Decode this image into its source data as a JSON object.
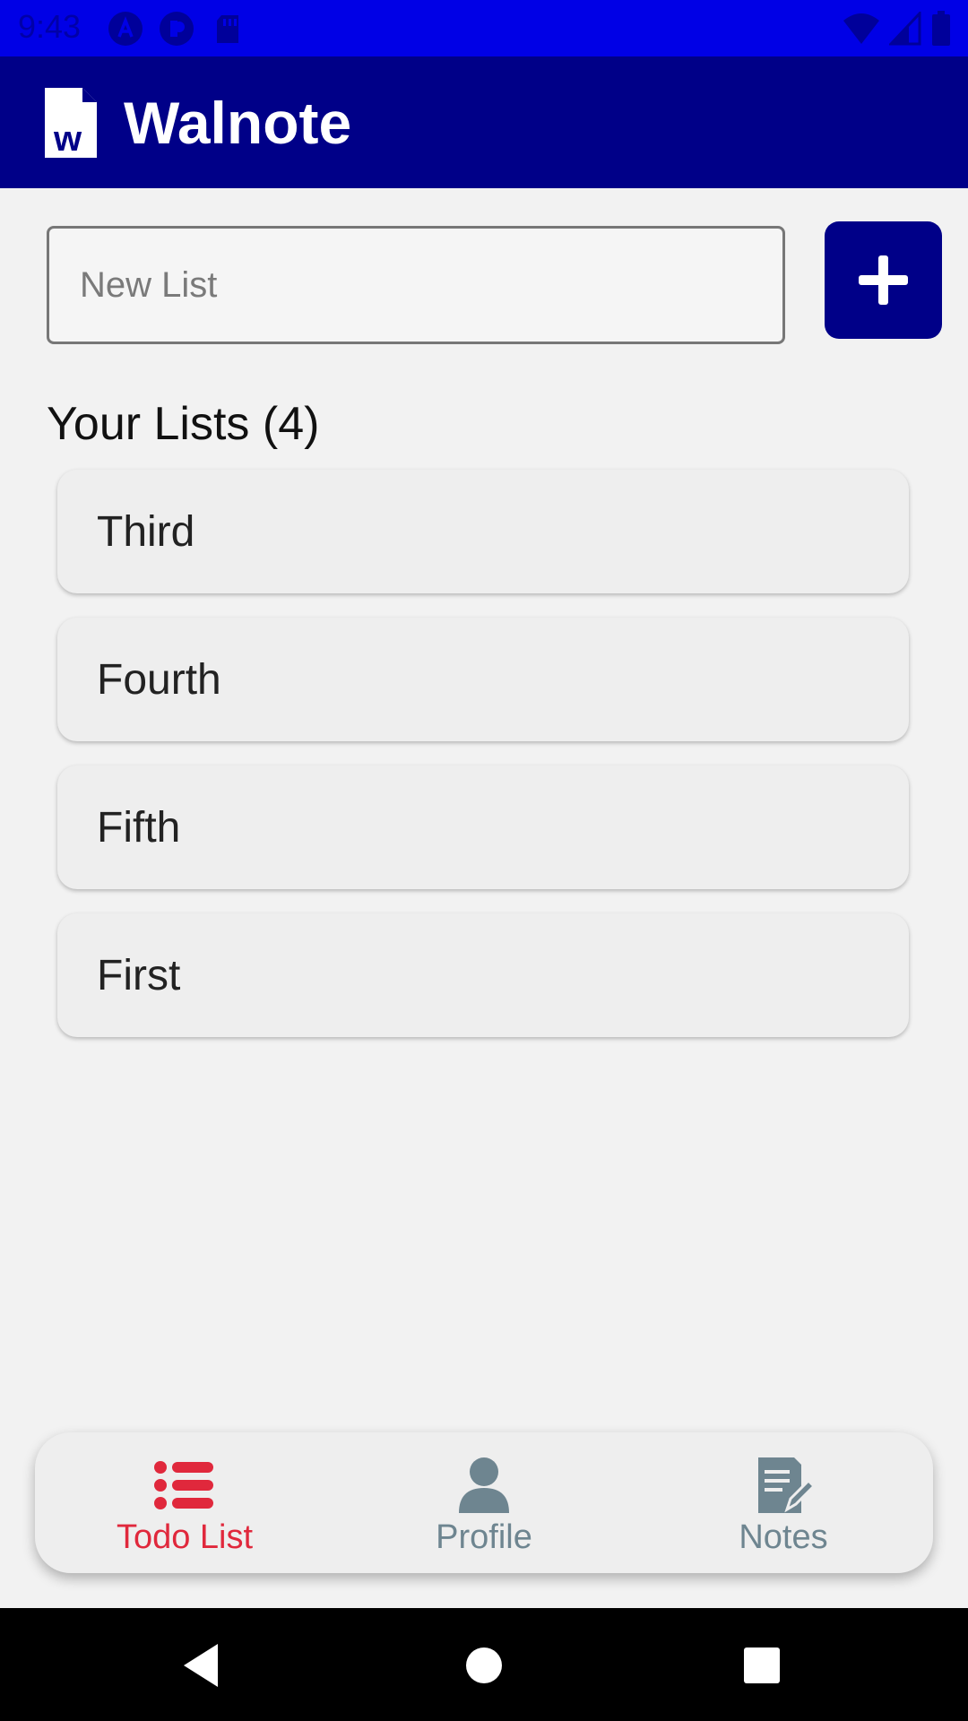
{
  "status_bar": {
    "time": "9:43",
    "icons": [
      "accessibility-icon",
      "sync-icon",
      "sd-card-icon",
      "wifi-icon",
      "signal-icon",
      "battery-icon"
    ]
  },
  "app_bar": {
    "title": "Walnote",
    "logo_letter": "w",
    "color": "#000088"
  },
  "new_list": {
    "placeholder": "New List",
    "value": "",
    "add_icon": "plus-icon"
  },
  "lists_section": {
    "title": "Your Lists (4)",
    "items": [
      {
        "label": "Third"
      },
      {
        "label": "Fourth"
      },
      {
        "label": "Fifth"
      },
      {
        "label": "First"
      }
    ]
  },
  "bottom_nav": {
    "items": [
      {
        "label": "Todo List",
        "icon": "list-icon",
        "active": true
      },
      {
        "label": "Profile",
        "icon": "user-icon",
        "active": false
      },
      {
        "label": "Notes",
        "icon": "notes-icon",
        "active": false
      }
    ],
    "active_color": "#e0283c",
    "inactive_color": "#6e8590"
  },
  "system_nav": {
    "buttons": [
      "back-icon",
      "home-icon",
      "recents-icon"
    ]
  }
}
